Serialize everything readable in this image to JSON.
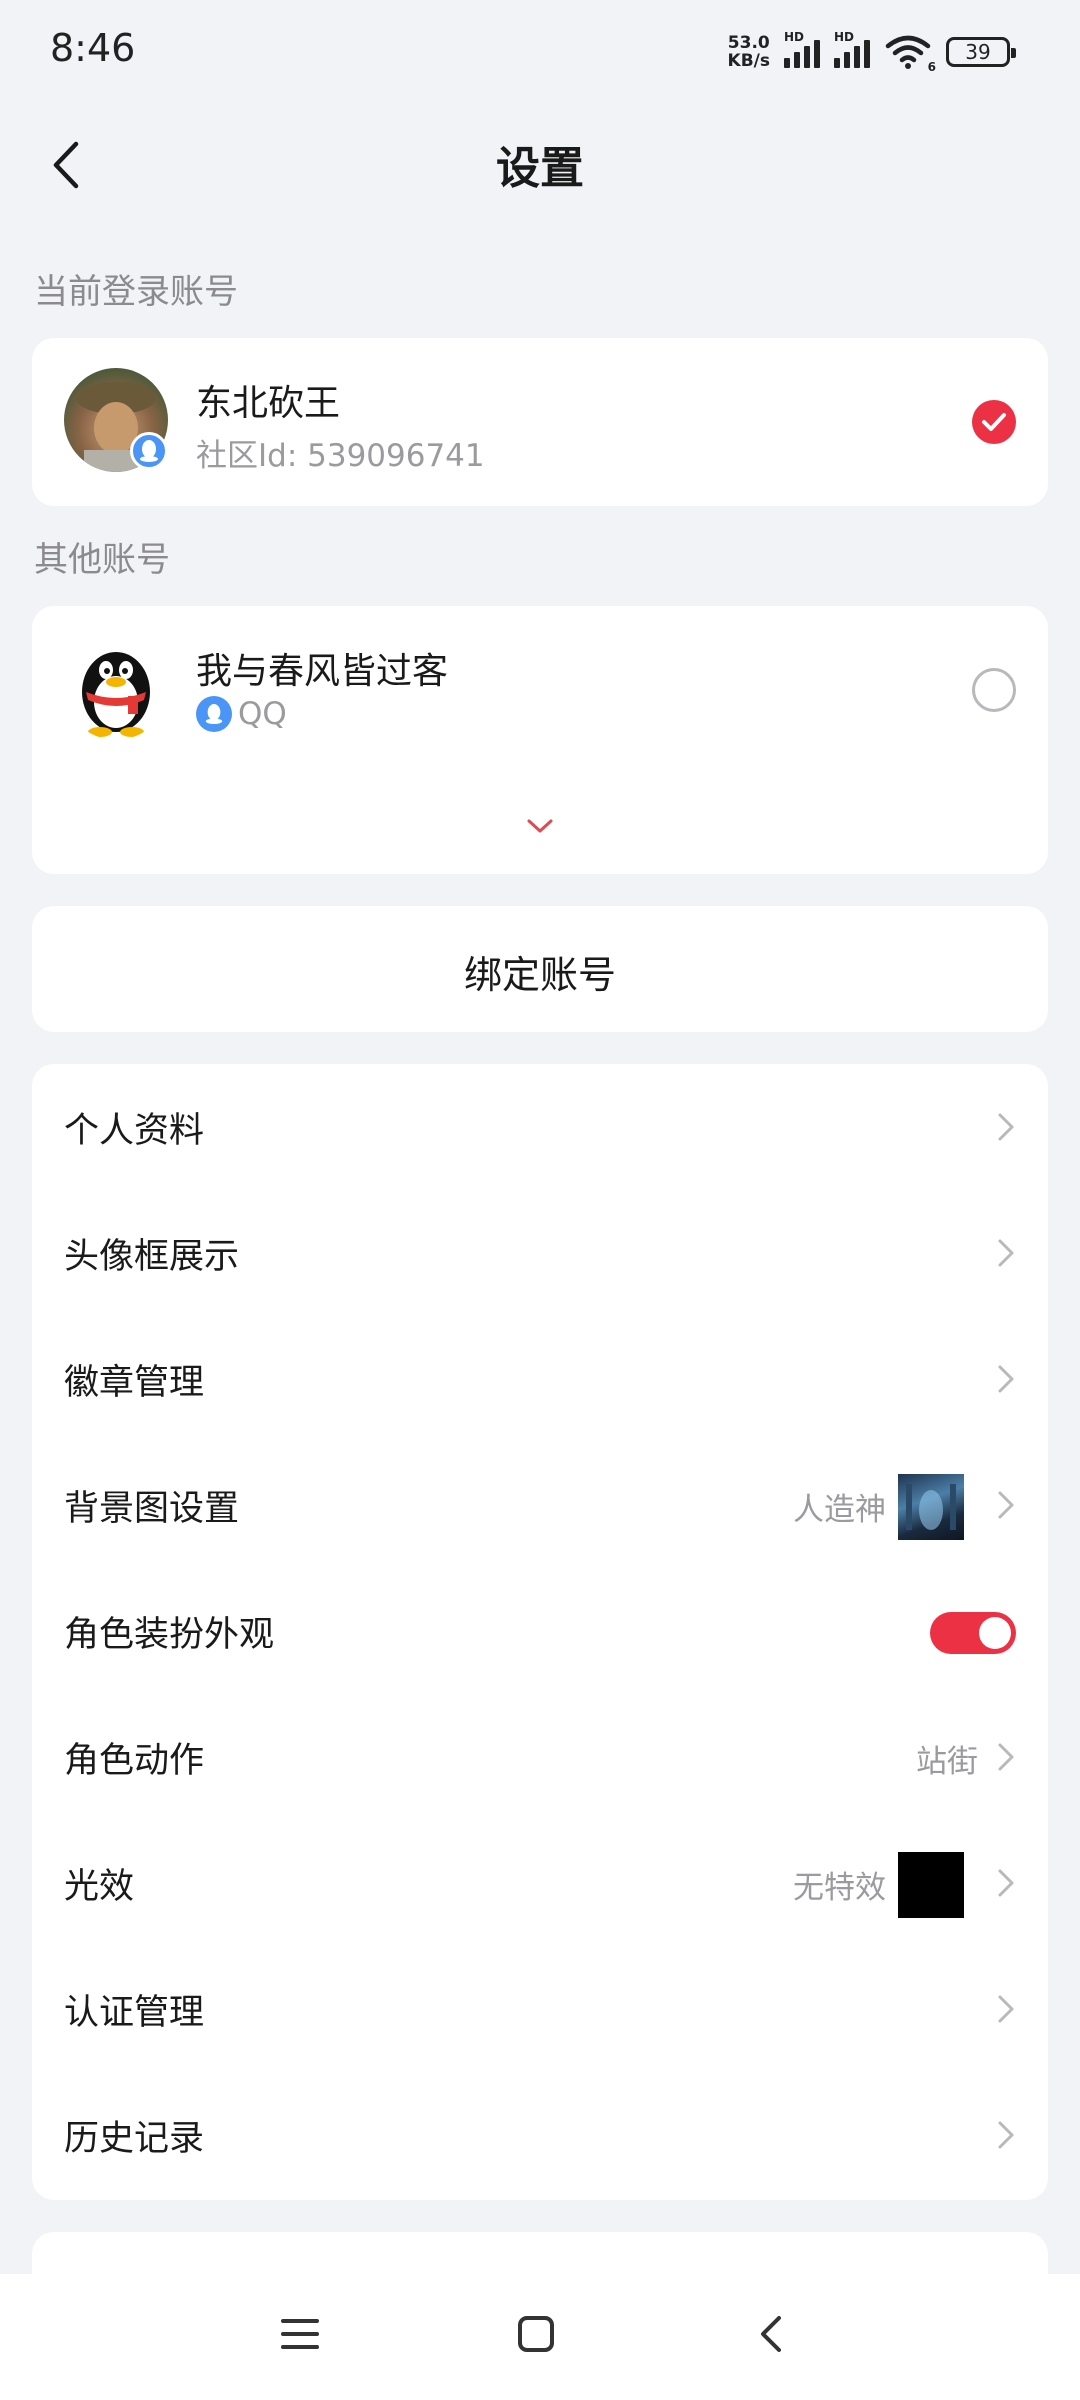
{
  "status_bar": {
    "time": "8:46",
    "net_speed_value": "53.0",
    "net_speed_unit": "KB/s",
    "signal_badge": "HD",
    "wifi_badge": "6",
    "battery": "39"
  },
  "header": {
    "title": "设置",
    "back_icon": "chevron-left-icon"
  },
  "current_account": {
    "section_label": "当前登录账号",
    "name": "东北砍王",
    "community_id": "社区Id: 539096741",
    "badge_icon": "qq-icon",
    "selected": true
  },
  "other_accounts": {
    "section_label": "其他账号",
    "items": [
      {
        "name": "我与春风皆过客",
        "platform": "QQ",
        "platform_icon": "qq-icon",
        "selected": false
      }
    ],
    "expand_icon": "chevron-down-icon"
  },
  "bind_account": {
    "label": "绑定账号"
  },
  "settings": {
    "items": [
      {
        "label": "个人资料"
      },
      {
        "label": "头像框展示"
      },
      {
        "label": "徽章管理"
      },
      {
        "label": "背景图设置",
        "value": "人造神"
      },
      {
        "label": "角色装扮外观",
        "toggle_on": true
      },
      {
        "label": "角色动作",
        "value": "站街"
      },
      {
        "label": "光效",
        "value": "无特效"
      },
      {
        "label": "认证管理"
      },
      {
        "label": "历史记录"
      }
    ]
  },
  "colors": {
    "accent": "#ec3145",
    "background": "#f2f3f7",
    "card": "#ffffff",
    "secondary_text": "#9a9a9f"
  },
  "bottom_nav": {
    "icons": [
      "menu-icon",
      "home-square-icon",
      "back-triangle-icon"
    ]
  }
}
